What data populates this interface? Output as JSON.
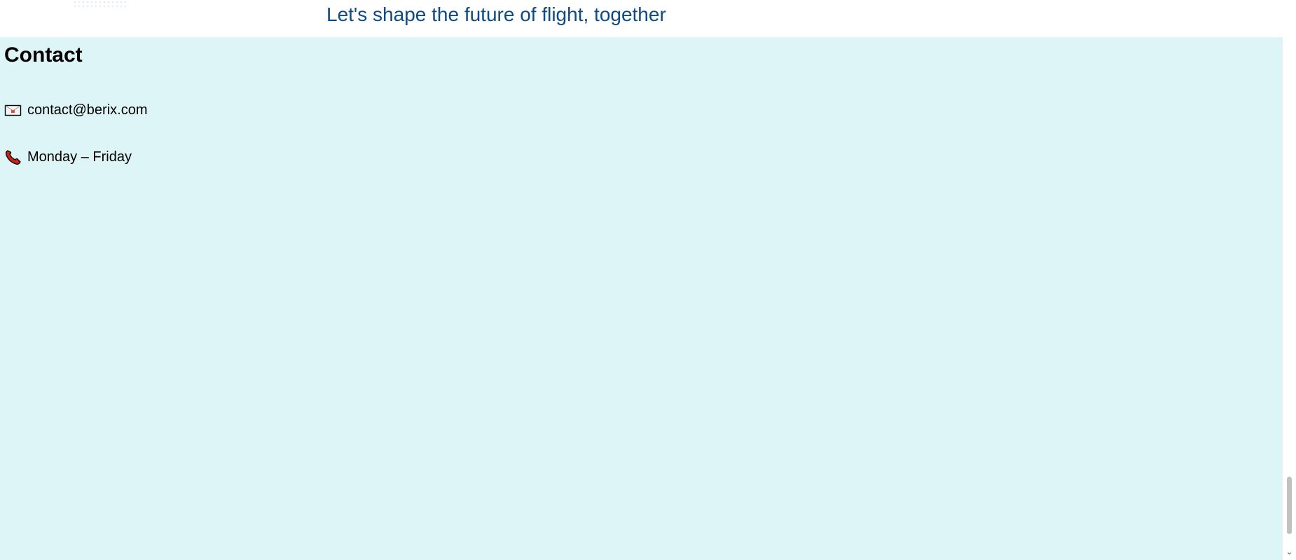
{
  "header": {
    "tagline": "Let's shape the future of flight, together"
  },
  "contact": {
    "title": "Contact",
    "email": {
      "icon": "envelope-icon",
      "text": "contact@berix.com"
    },
    "hours": {
      "icon": "telephone-icon",
      "text": "Monday – Friday"
    }
  },
  "scrollbar": {
    "down_arrow_icon": "chevron-down-icon"
  },
  "colors": {
    "tagline": "#0f4a80",
    "contact_background": "#def5f8",
    "phone_icon": "#d0201a"
  }
}
